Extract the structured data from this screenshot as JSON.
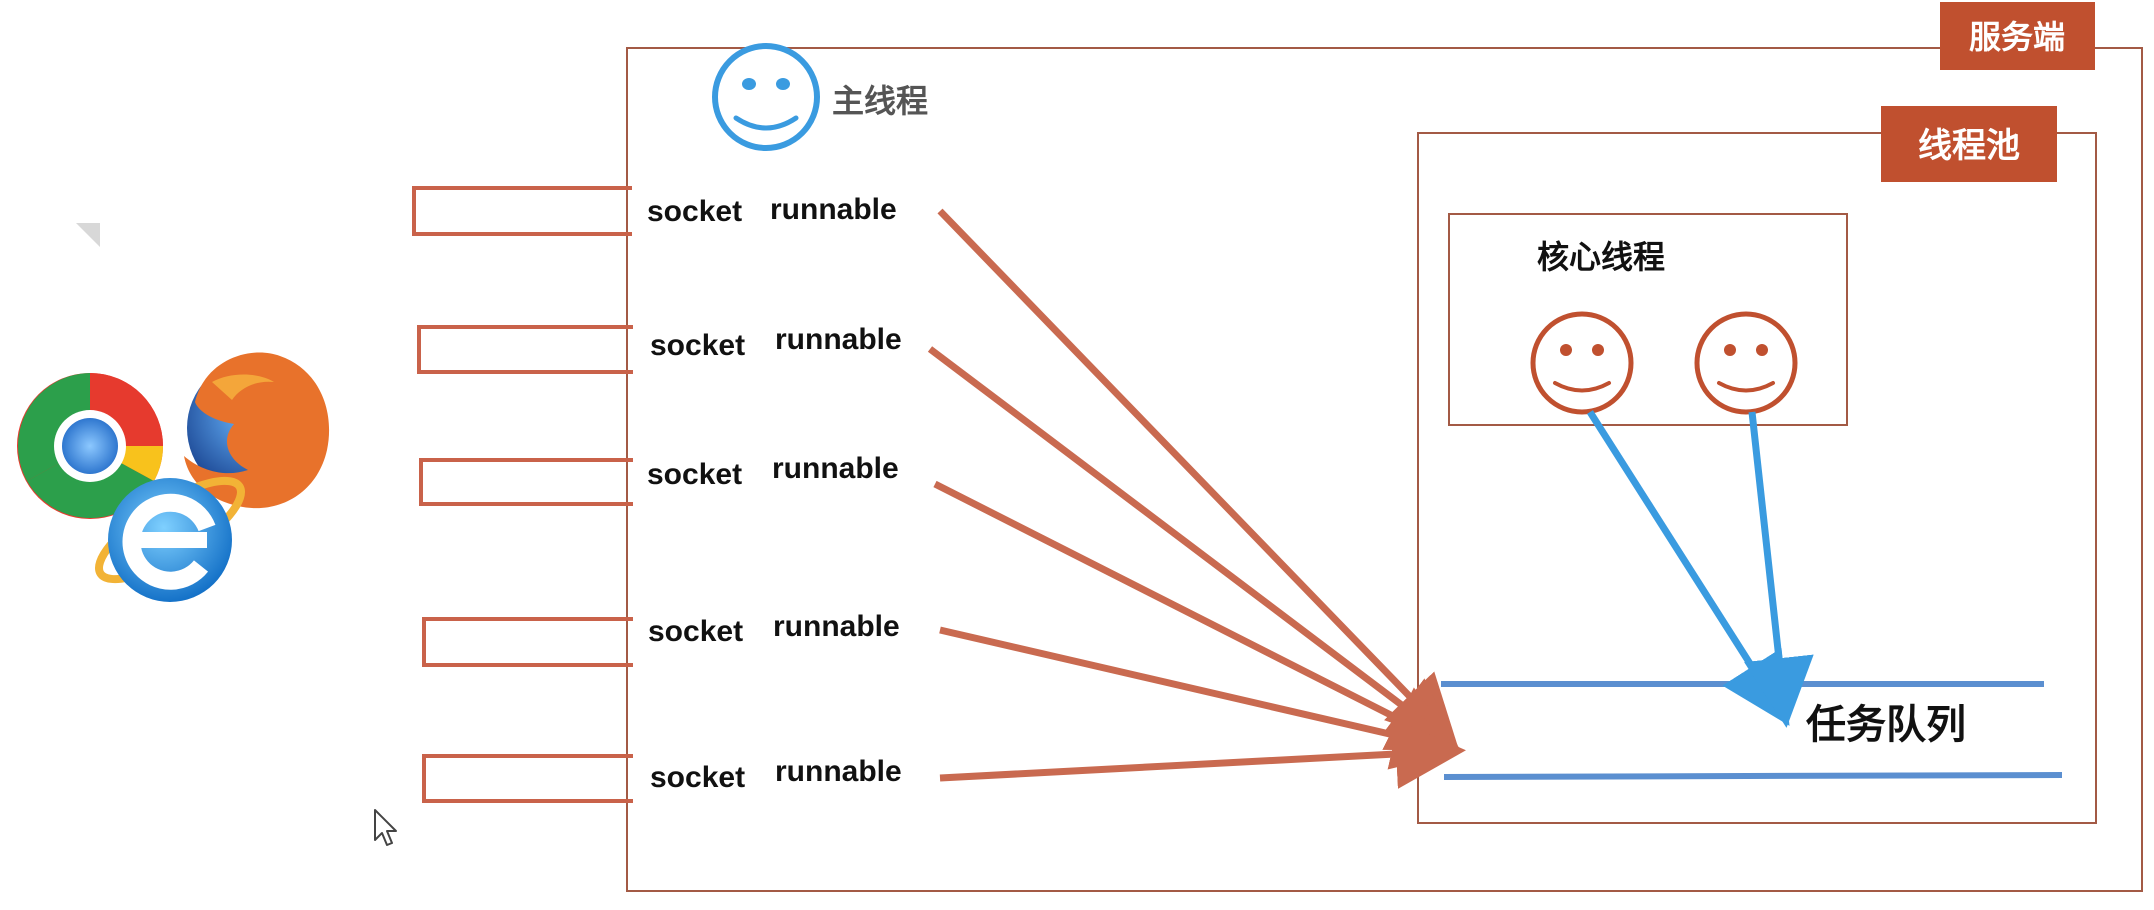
{
  "server": {
    "label": "服务端",
    "main_thread_label": "主线程"
  },
  "thread_pool": {
    "label": "线程池",
    "core_threads_label": "核心线程",
    "task_queue_label": "任务队列"
  },
  "requests": [
    {
      "socket": "socket",
      "runnable": "runnable"
    },
    {
      "socket": "socket",
      "runnable": "runnable"
    },
    {
      "socket": "socket",
      "runnable": "runnable"
    },
    {
      "socket": "socket",
      "runnable": "runnable"
    },
    {
      "socket": "socket",
      "runnable": "runnable"
    }
  ],
  "browsers": [
    "chrome-icon",
    "firefox-icon",
    "internet-explorer-icon"
  ],
  "colors": {
    "accent_red": "#c0502f",
    "arrow_red": "#c96a50",
    "accent_blue": "#3a9be0",
    "queue_blue": "#5b8fd0",
    "box_border": "#a35a45",
    "text_dark": "#111111",
    "text_gray": "#555555"
  }
}
